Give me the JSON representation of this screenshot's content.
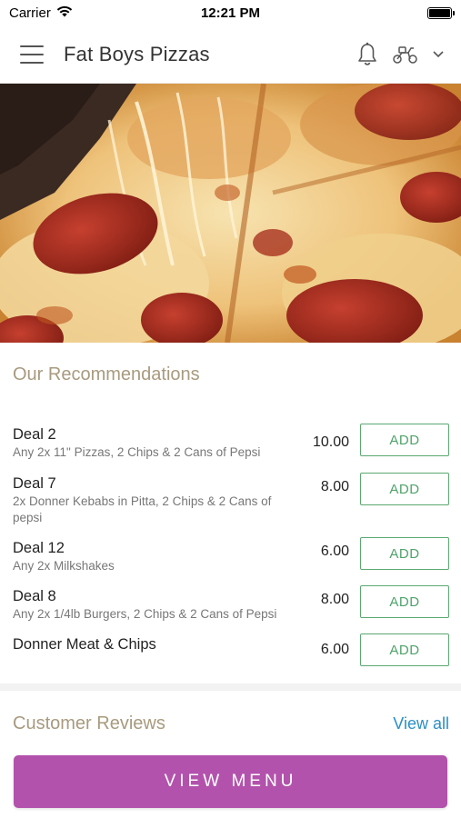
{
  "status_bar": {
    "carrier": "Carrier",
    "time": "12:21 PM",
    "icons": [
      "wifi-icon",
      "battery-icon"
    ]
  },
  "header": {
    "title": "Fat Boys Pizzas",
    "icons": [
      "menu-icon",
      "bell-icon",
      "scooter-icon",
      "chevron-down-icon"
    ]
  },
  "hero": {
    "image": "pizza-photo"
  },
  "recommendations": {
    "title": "Our Recommendations",
    "items": [
      {
        "name": "Deal 2",
        "description": "Any 2x 11\" Pizzas, 2 Chips & 2 Cans of Pepsi",
        "price": "10.00",
        "button": "ADD"
      },
      {
        "name": "Deal 7",
        "description": "2x Donner Kebabs in Pitta, 2 Chips & 2 Cans of pepsi",
        "price": "8.00",
        "button": "ADD"
      },
      {
        "name": "Deal 12",
        "description": "Any 2x Milkshakes",
        "price": "6.00",
        "button": "ADD"
      },
      {
        "name": "Deal 8",
        "description": "Any 2x 1/4lb Burgers, 2 Chips & 2 Cans of Pepsi",
        "price": "8.00",
        "button": "ADD"
      },
      {
        "name": "Donner Meat & Chips",
        "description": "",
        "price": "6.00",
        "button": "ADD"
      }
    ]
  },
  "reviews": {
    "title": "Customer Reviews",
    "view_all": "View all"
  },
  "footer": {
    "button": "VIEW MENU"
  },
  "colors": {
    "accent_purple": "#b352ac",
    "add_green": "#4fa36a",
    "link_blue": "#2b8fc7",
    "section_title": "#a89a7f"
  }
}
